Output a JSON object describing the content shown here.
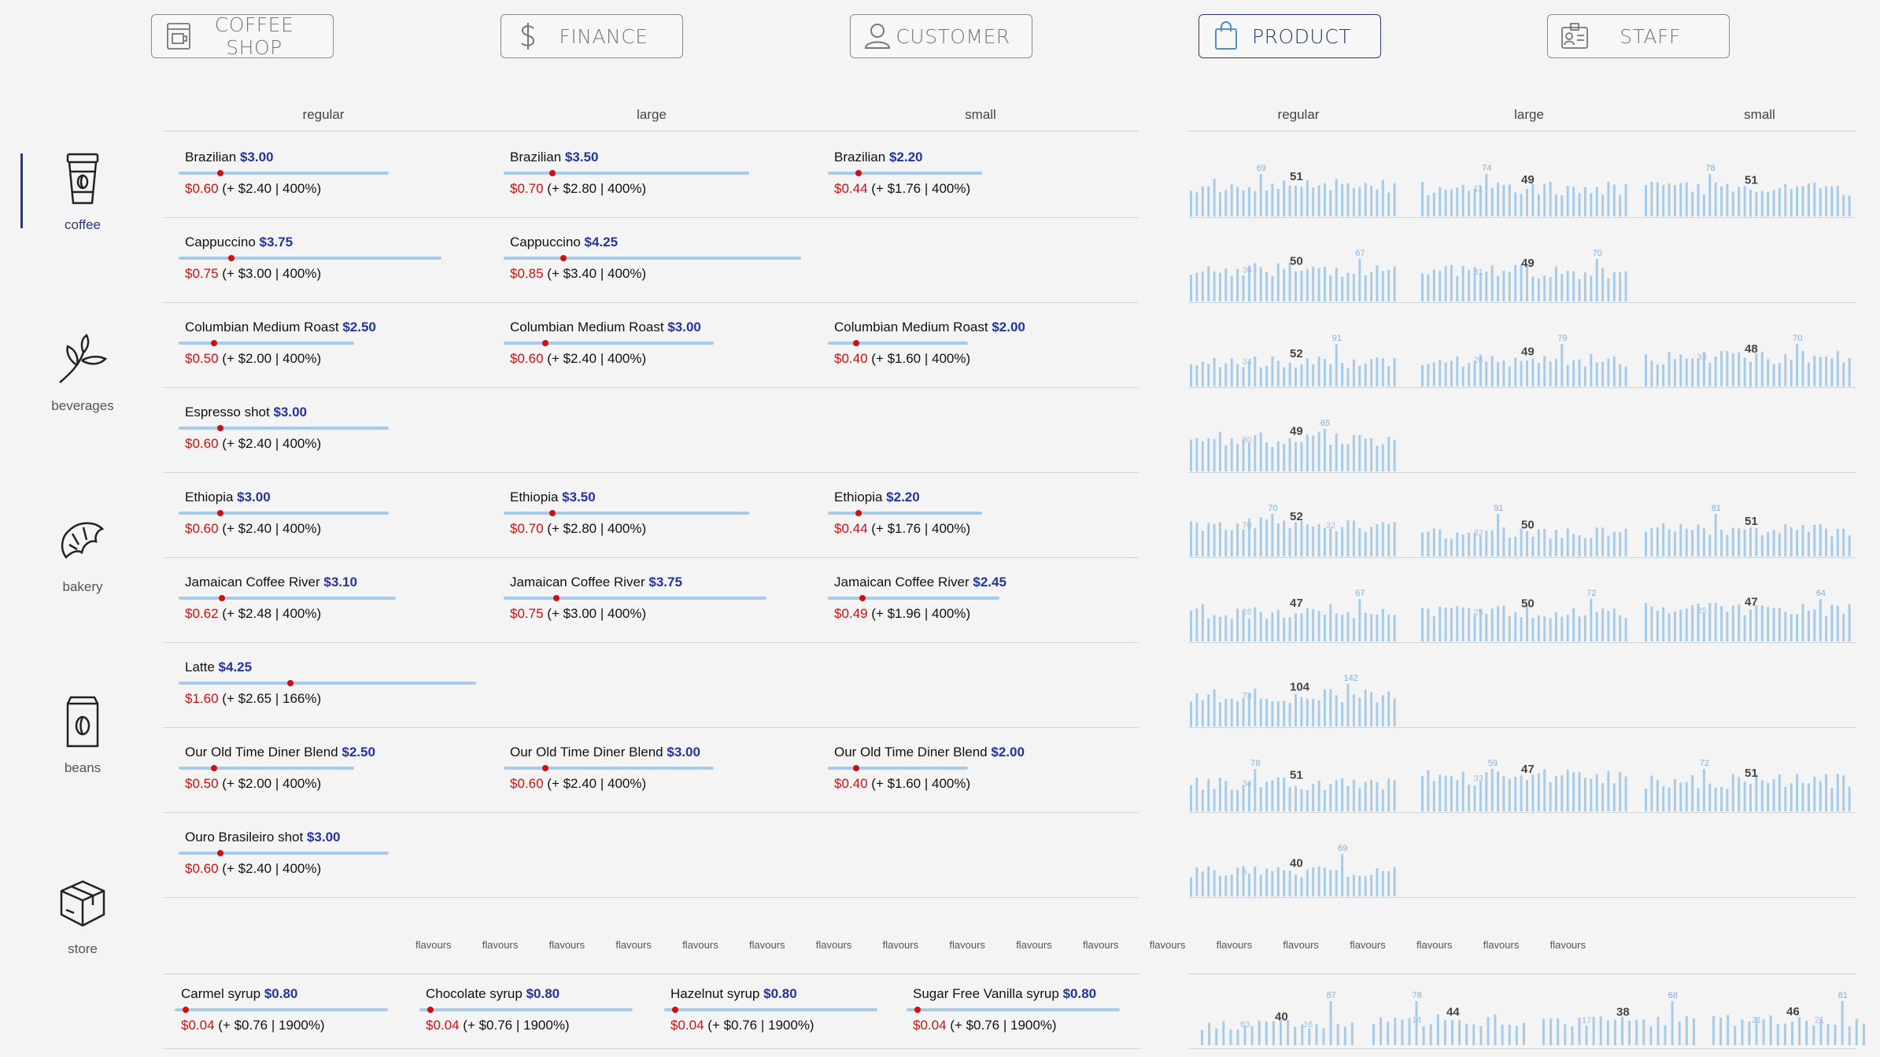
{
  "nav": [
    {
      "label": "COFFEE SHOP",
      "icon": "coffee-machine-icon"
    },
    {
      "label": "FINANCE",
      "icon": "dollar-icon"
    },
    {
      "label": "CUSTOMER",
      "icon": "user-icon"
    },
    {
      "label": "PRODUCT",
      "icon": "shopping-bag-icon",
      "active": true
    },
    {
      "label": "STAFF",
      "icon": "id-card-icon"
    }
  ],
  "sidebar": [
    {
      "label": "coffee",
      "icon": "coffee-cup-icon",
      "active": true
    },
    {
      "label": "beverages",
      "icon": "tea-leaf-icon"
    },
    {
      "label": "bakery",
      "icon": "croissant-icon"
    },
    {
      "label": "beans",
      "icon": "coffee-bag-icon"
    },
    {
      "label": "store",
      "icon": "box-icon"
    }
  ],
  "size_headers": [
    "regular",
    "large",
    "small"
  ],
  "chart_headers": [
    "regular",
    "large",
    "small"
  ],
  "colors": {
    "accent": "#2b3a73",
    "price": "#2433a0",
    "cost": "#d01010",
    "bar": "#a7cbea"
  },
  "rows": [
    {
      "cells": [
        {
          "name": "Brazilian",
          "price": "$3.00",
          "cost": "$0.60",
          "rest": "(+ $2.40 | 400%)",
          "price_value": 3.0,
          "cost_value": 0.6
        },
        {
          "name": "Brazilian",
          "price": "$3.50",
          "cost": "$0.70",
          "rest": "(+ $2.80 | 400%)",
          "price_value": 3.5,
          "cost_value": 0.7
        },
        {
          "name": "Brazilian",
          "price": "$2.20",
          "cost": "$0.44",
          "rest": "(+ $1.76 | 400%)",
          "price_value": 2.2,
          "cost_value": 0.44
        }
      ],
      "sparks": [
        {
          "avg": "51",
          "max": "69",
          "labels": []
        },
        {
          "avg": "49",
          "max": "74",
          "labels": [
            "11"
          ]
        },
        {
          "avg": "51",
          "max": "78",
          "labels": []
        }
      ]
    },
    {
      "cells": [
        {
          "name": "Cappuccino",
          "price": "$3.75",
          "cost": "$0.75",
          "rest": "(+ $3.00 | 400%)",
          "price_value": 3.75,
          "cost_value": 0.75
        },
        {
          "name": "Cappuccino",
          "price": "$4.25",
          "cost": "$0.85",
          "rest": "(+ $3.40 | 400%)",
          "price_value": 4.25,
          "cost_value": 0.85
        },
        null
      ],
      "sparks": [
        {
          "avg": "50",
          "max": "67",
          "labels": [
            "36"
          ]
        },
        {
          "avg": "49",
          "max": "70",
          "labels": [
            "31"
          ]
        },
        null
      ]
    },
    {
      "cells": [
        {
          "name": "Columbian Medium Roast",
          "price": "$2.50",
          "cost": "$0.50",
          "rest": "(+ $2.00 | 400%)",
          "price_value": 2.5,
          "cost_value": 0.5
        },
        {
          "name": "Columbian Medium Roast",
          "price": "$3.00",
          "cost": "$0.60",
          "rest": "(+ $2.40 | 400%)",
          "price_value": 3.0,
          "cost_value": 0.6
        },
        {
          "name": "Columbian Medium Roast",
          "price": "$2.00",
          "cost": "$0.40",
          "rest": "(+ $1.60 | 400%)",
          "price_value": 2.0,
          "cost_value": 0.4
        }
      ],
      "sparks": [
        {
          "avg": "52",
          "max": "91",
          "labels": [
            "34"
          ]
        },
        {
          "avg": "49",
          "max": "79",
          "labels": [
            "26"
          ]
        },
        {
          "avg": "48",
          "max": "70",
          "labels": [
            "33"
          ]
        }
      ]
    },
    {
      "cells": [
        {
          "name": "Espresso shot",
          "price": "$3.00",
          "cost": "$0.60",
          "rest": "(+ $2.40 | 400%)",
          "price_value": 3.0,
          "cost_value": 0.6
        },
        null,
        null
      ],
      "sparks": [
        {
          "avg": "49",
          "max": "65",
          "labels": [
            "30"
          ]
        },
        null,
        null
      ]
    },
    {
      "cells": [
        {
          "name": "Ethiopia",
          "price": "$3.00",
          "cost": "$0.60",
          "rest": "(+ $2.40 | 400%)",
          "price_value": 3.0,
          "cost_value": 0.6
        },
        {
          "name": "Ethiopia",
          "price": "$3.50",
          "cost": "$0.70",
          "rest": "(+ $2.80 | 400%)",
          "price_value": 3.5,
          "cost_value": 0.7
        },
        {
          "name": "Ethiopia",
          "price": "$2.20",
          "cost": "$0.44",
          "rest": "(+ $1.76 | 400%)",
          "price_value": 2.2,
          "cost_value": 0.44
        }
      ],
      "sparks": [
        {
          "avg": "52",
          "max": "70",
          "labels": [
            "70",
            "32"
          ]
        },
        {
          "avg": "50",
          "max": "91",
          "labels": [
            "32"
          ]
        },
        {
          "avg": "51",
          "max": "81",
          "labels": []
        }
      ]
    },
    {
      "cells": [
        {
          "name": "Jamaican Coffee River",
          "price": "$3.10",
          "cost": "$0.62",
          "rest": "(+ $2.48 | 400%)",
          "price_value": 3.1,
          "cost_value": 0.62
        },
        {
          "name": "Jamaican Coffee River",
          "price": "$3.75",
          "cost": "$0.75",
          "rest": "(+ $3.00 | 400%)",
          "price_value": 3.75,
          "cost_value": 0.75
        },
        {
          "name": "Jamaican Coffee River",
          "price": "$2.45",
          "cost": "$0.49",
          "rest": "(+ $1.96 | 400%)",
          "price_value": 2.45,
          "cost_value": 0.49
        }
      ],
      "sparks": [
        {
          "avg": "47",
          "max": "67",
          "labels": [
            "26"
          ]
        },
        {
          "avg": "50",
          "max": "72",
          "labels": [
            "25"
          ]
        },
        {
          "avg": "47",
          "max": "64",
          "labels": [
            "25"
          ]
        }
      ]
    },
    {
      "cells": [
        {
          "name": "Latte",
          "price": "$4.25",
          "cost": "$1.60",
          "rest": "(+ $2.65 | 166%)",
          "price_value": 4.25,
          "cost_value": 1.6
        },
        null,
        null
      ],
      "sparks": [
        {
          "avg": "104",
          "max": "142",
          "labels": [
            "78"
          ]
        },
        null,
        null
      ]
    },
    {
      "cells": [
        {
          "name": "Our Old Time Diner Blend",
          "price": "$2.50",
          "cost": "$0.50",
          "rest": "(+ $2.00 | 400%)",
          "price_value": 2.5,
          "cost_value": 0.5
        },
        {
          "name": "Our Old Time Diner Blend",
          "price": "$3.00",
          "cost": "$0.60",
          "rest": "(+ $2.40 | 400%)",
          "price_value": 3.0,
          "cost_value": 0.6
        },
        {
          "name": "Our Old Time Diner Blend",
          "price": "$2.00",
          "cost": "$0.40",
          "rest": "(+ $1.60 | 400%)",
          "price_value": 2.0,
          "cost_value": 0.4
        }
      ],
      "sparks": [
        {
          "avg": "51",
          "max": "78",
          "labels": [
            "34"
          ]
        },
        {
          "avg": "47",
          "max": "59",
          "labels": [
            "33"
          ]
        },
        {
          "avg": "51",
          "max": "72",
          "labels": []
        }
      ]
    },
    {
      "cells": [
        {
          "name": "Ouro Brasileiro shot",
          "price": "$3.00",
          "cost": "$0.60",
          "rest": "(+ $2.40 | 400%)",
          "price_value": 3.0,
          "cost_value": 0.6
        },
        null,
        null
      ],
      "sparks": [
        {
          "avg": "40",
          "max": "69",
          "labels": [
            "5"
          ]
        },
        null,
        null
      ]
    }
  ],
  "flavours_label": "flavours",
  "flavour_count": 18,
  "flavours": [
    {
      "name": "Carmel syrup",
      "price": "$0.80",
      "cost": "$0.04",
      "rest": "(+ $0.76 | 1900%)",
      "price_value": 0.8,
      "cost_value": 0.04
    },
    {
      "name": "Chocolate syrup",
      "price": "$0.80",
      "cost": "$0.04",
      "rest": "(+ $0.76 | 1900%)",
      "price_value": 0.8,
      "cost_value": 0.04
    },
    {
      "name": "Hazelnut syrup",
      "price": "$0.80",
      "cost": "$0.04",
      "rest": "(+ $0.76 | 1900%)",
      "price_value": 0.8,
      "cost_value": 0.04
    },
    {
      "name": "Sugar Free Vanilla syrup",
      "price": "$0.80",
      "cost": "$0.04",
      "rest": "(+ $0.76 | 1900%)",
      "price_value": 0.8,
      "cost_value": 0.04
    }
  ],
  "flavour_sparks": [
    {
      "avg": "40",
      "max": "87",
      "labels": [
        "63",
        "16",
        "16"
      ]
    },
    {
      "avg": "44",
      "max": "78",
      "labels": [
        "14"
      ]
    },
    {
      "avg": "38",
      "max": "68",
      "labels": [
        "17"
      ]
    },
    {
      "avg": "46",
      "max": "81",
      "labels": [
        "21",
        "21"
      ]
    }
  ]
}
